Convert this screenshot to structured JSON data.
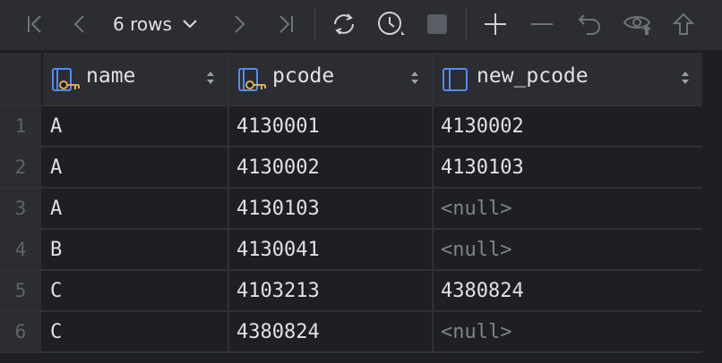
{
  "toolbar": {
    "rows_label": "6 rows",
    "buttons": [
      {
        "name": "first-page-icon"
      },
      {
        "name": "previous-page-icon"
      },
      {
        "name": "next-page-icon"
      },
      {
        "name": "last-page-icon"
      },
      {
        "name": "reload-icon"
      },
      {
        "name": "history-icon"
      },
      {
        "name": "stop-icon"
      },
      {
        "name": "add-row-icon"
      },
      {
        "name": "delete-row-icon"
      },
      {
        "name": "revert-icon"
      },
      {
        "name": "preview-changes-icon"
      },
      {
        "name": "submit-icon"
      }
    ]
  },
  "table": {
    "columns": [
      {
        "label": "name",
        "icon": "key-column-icon"
      },
      {
        "label": "pcode",
        "icon": "key-column-icon"
      },
      {
        "label": "new_pcode",
        "icon": "column-icon"
      }
    ],
    "rows": [
      {
        "num": "1",
        "cells": [
          "A",
          "4130001",
          "4130002"
        ]
      },
      {
        "num": "2",
        "cells": [
          "A",
          "4130002",
          "4130103"
        ]
      },
      {
        "num": "3",
        "cells": [
          "A",
          "4130103",
          "<null>"
        ]
      },
      {
        "num": "4",
        "cells": [
          "B",
          "4130041",
          "<null>"
        ]
      },
      {
        "num": "5",
        "cells": [
          "C",
          "4103213",
          "4380824"
        ]
      },
      {
        "num": "6",
        "cells": [
          "C",
          "4380824",
          "<null>"
        ]
      }
    ]
  },
  "colors": {
    "background": "#1e1f22",
    "header": "#2b2d30",
    "text": "#dfe1e5",
    "muted": "#6f737a",
    "key_icon_blue": "#548af7",
    "key_icon_gold": "#d6ae58"
  }
}
